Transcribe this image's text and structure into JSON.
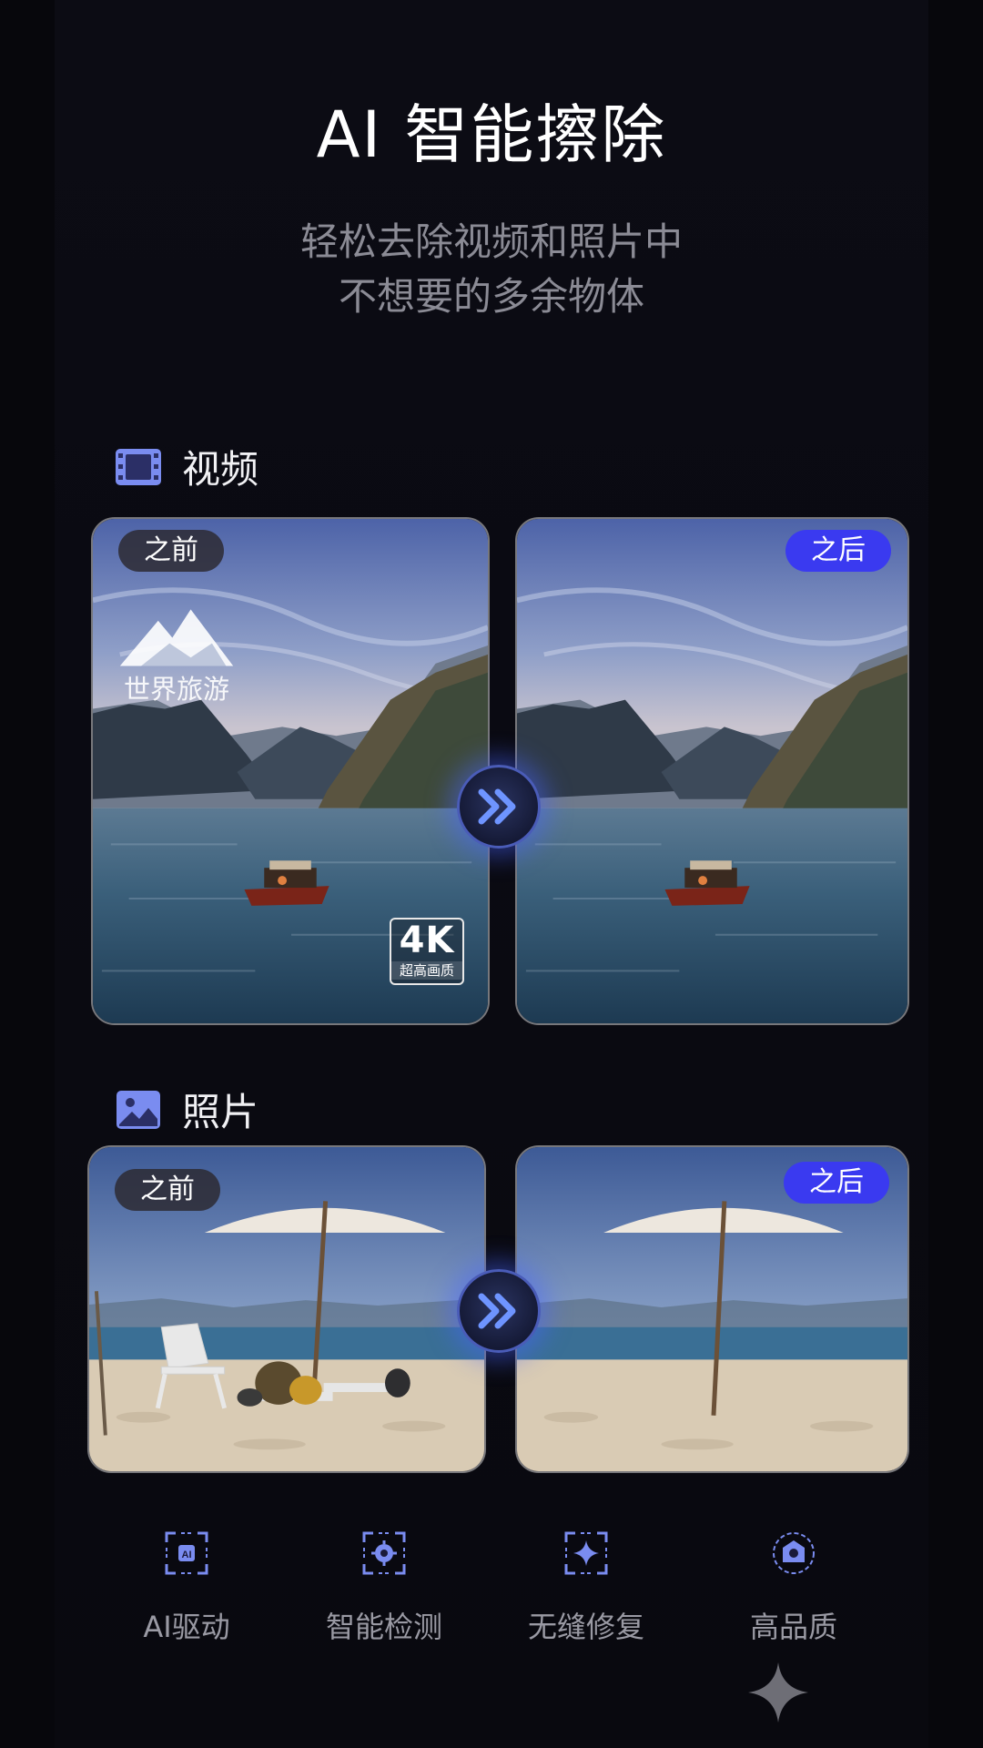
{
  "header": {
    "title": "AI 智能擦除",
    "subtitle_line1": "轻松去除视频和照片中",
    "subtitle_line2": "不想要的多余物体"
  },
  "video_section": {
    "icon": "film-icon",
    "label": "视频",
    "before_tag": "之前",
    "after_tag": "之后",
    "watermark_text": "世界旅游",
    "badge_big": "4K",
    "badge_small": "超高画质"
  },
  "photo_section": {
    "icon": "image-icon",
    "label": "照片",
    "before_tag": "之前",
    "after_tag": "之后"
  },
  "features": [
    {
      "icon": "ai-scan-icon",
      "label": "AI驱动"
    },
    {
      "icon": "detect-icon",
      "label": "智能检测"
    },
    {
      "icon": "repair-sparkle-icon",
      "label": "无缝修复"
    },
    {
      "icon": "quality-badge-icon",
      "label": "高品质"
    }
  ],
  "colors": {
    "accent": "#3a3af0",
    "icon_blue": "#7a8cf0"
  }
}
